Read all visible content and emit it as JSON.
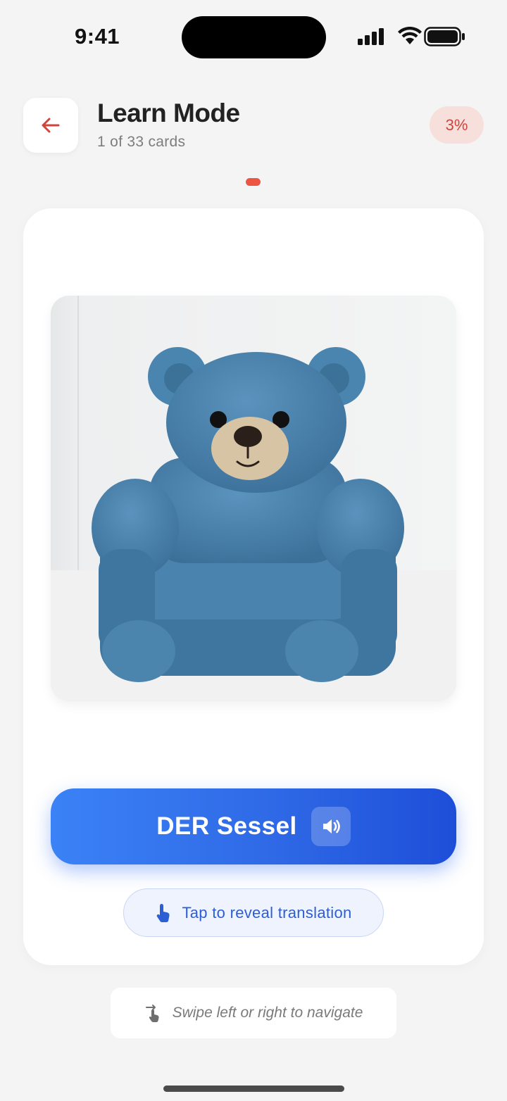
{
  "status_bar": {
    "time": "9:41"
  },
  "header": {
    "title": "Learn Mode",
    "subtitle": "1 of 33 cards",
    "progress": "3%",
    "back_icon": "arrow-left-icon"
  },
  "card": {
    "image_subject": "blue teddy bear armchair",
    "word": "DER Sessel",
    "speaker_icon": "speaker-volume-icon",
    "reveal_label": "Tap to reveal translation",
    "reveal_icon": "tap-finger-icon"
  },
  "footer": {
    "swipe_hint": "Swipe left or right to navigate",
    "swipe_icon": "swipe-gesture-icon"
  },
  "colors": {
    "accent_red": "#ee5443",
    "primary_blue": "#2f69e6",
    "background": "#f4f4f4"
  }
}
